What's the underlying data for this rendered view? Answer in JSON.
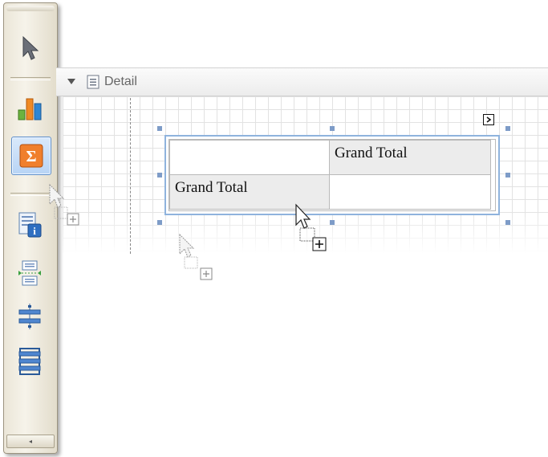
{
  "toolbox": {
    "tools": [
      {
        "name": "pointer-tool",
        "icon": "arrow-pointer-icon",
        "active": false
      },
      {
        "name": "chart-tool",
        "icon": "bar-chart-icon",
        "active": false
      },
      {
        "name": "cross-tab-tool",
        "icon": "sigma-icon",
        "active": true
      },
      {
        "name": "page-info-tool",
        "icon": "page-info-icon",
        "active": false
      },
      {
        "name": "page-break-tool",
        "icon": "page-break-icon",
        "active": false
      },
      {
        "name": "cross-band-line-tool",
        "icon": "cross-band-line-icon",
        "active": false
      },
      {
        "name": "cross-band-box-tool",
        "icon": "cross-band-box-icon",
        "active": false
      }
    ],
    "scroll_arrow": "◂"
  },
  "band": {
    "label": "Detail",
    "icon": "detail-band-icon"
  },
  "cross_tab": {
    "column_total_label": "Grand Total",
    "row_total_label": "Grand Total",
    "data_cell": "",
    "corner_cell": ""
  },
  "smart_tag_glyph": "›",
  "colors": {
    "selection_accent": "#5d8ecb",
    "handle": "#7e9cc8",
    "chart_bars": [
      "#6cb33f",
      "#f08a24",
      "#2f86d3"
    ]
  }
}
